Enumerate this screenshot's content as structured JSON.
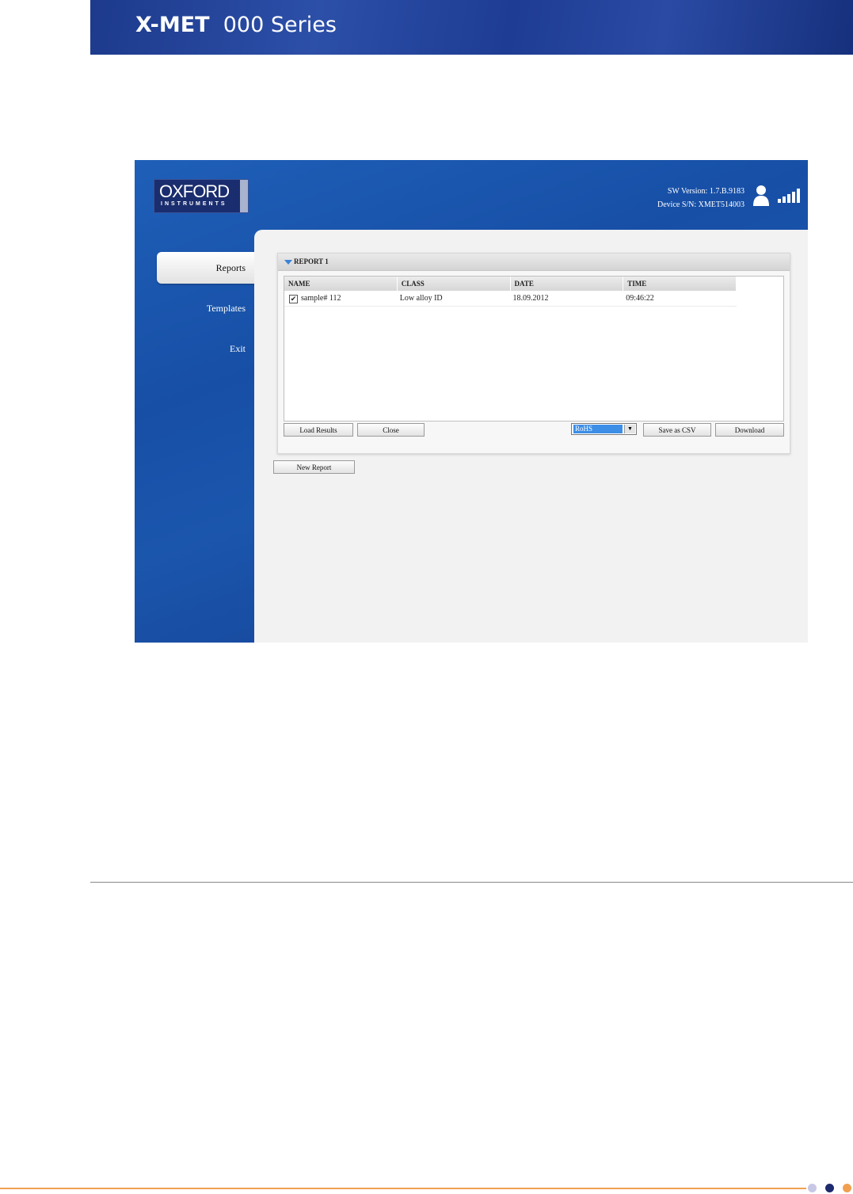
{
  "document": {
    "title_bold": "X-MET",
    "title_rest": "000 Series"
  },
  "app": {
    "logo": {
      "brand": "OXFORD",
      "sub": "INSTRUMENTS"
    },
    "sw_version": "SW Version: 1.7.B.9183",
    "device_sn": "Device S/N: XMET514003",
    "nav": [
      {
        "label": "Reports",
        "active": true
      },
      {
        "label": "Templates",
        "active": false
      },
      {
        "label": "Exit",
        "active": false
      }
    ],
    "report": {
      "title": "REPORT 1",
      "columns": [
        "NAME",
        "CLASS",
        "DATE",
        "TIME"
      ],
      "rows": [
        {
          "checked": true,
          "name": "sample# 112",
          "class": "Low alloy ID",
          "date": "18.09.2012",
          "time": "09:46:22"
        }
      ],
      "buttons": {
        "load_results": "Load Results",
        "close": "Close",
        "save_csv": "Save as CSV",
        "download": "Download"
      },
      "format_select": {
        "selected": "RoHS"
      }
    },
    "new_report_label": "New Report"
  },
  "colors": {
    "banner": "#1d3a8c",
    "app_background": "#1b56ad",
    "select_highlight": "#3d8ee6",
    "footer_line": "#f0a050",
    "dot_light": "#c8c8e6",
    "dot_dark": "#1e2a6e",
    "dot_orange": "#f0a050"
  },
  "icons": [
    "user-icon",
    "signal-icon",
    "dropdown-arrow-icon",
    "collapse-triangle-icon",
    "checkbox-checked-icon"
  ]
}
